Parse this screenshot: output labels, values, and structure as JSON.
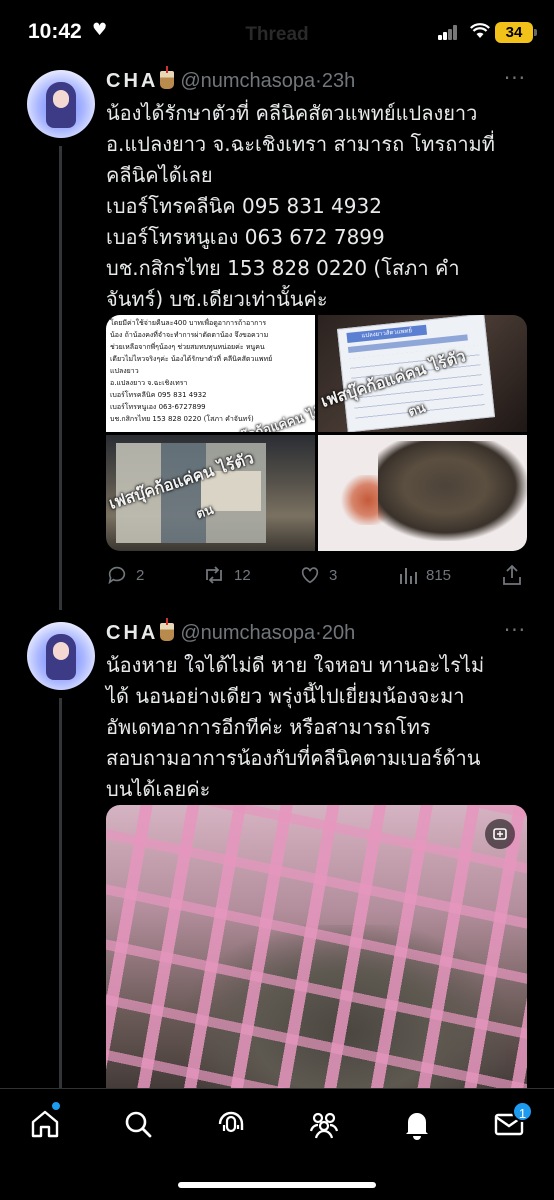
{
  "status_bar": {
    "time": "10:42",
    "header_title": "Thread",
    "battery": "34"
  },
  "tweets": [
    {
      "name": "CHA",
      "handle": "@numchasopa",
      "separator": "·",
      "time": "23h",
      "more": "···",
      "text_lines": [
        "น้องได้รักษาตัวที่ คลีนิคสัตวแพทย์แปลงยาว",
        "อ.แปลงยาว จ.ฉะเชิงเทรา สามารถ โทรถามที่",
        "คลีนิคได้เลย",
        "เบอร์โทรคลีนิค 095 831 4932",
        "เบอร์โทรหนูเอง 063 672 7899",
        "บช.กสิกรไทย 153 828 0220 (โสภา คำ",
        "จันทร์) บช.เดียวเท่านั้นค่ะ"
      ],
      "media_note_lines": [
        "โดยมีค่าใช้จ่ายคืนละ400 บาทเพื่อดูอาการถ้าอาการ",
        "น้อง ถ้าน้องคงที่จำจะทำการผ่าตัดตาน้อง จึงขอความ",
        "ช่วยเหลือจากพี่ๆน้องๆ ช่วยสมทบทุนหน่อยค่ะ หนูคน",
        "เดียวไม่ไหวจริงๆค่ะ น้องได้รักษาตัวที่ คลีนิคสัตวแพทย์",
        "แปลงยาว",
        "อ.แปลงยาว จ.ฉะเชิงเทรา",
        "เบอร์โทรคลีนิค 095 831 4932",
        "เบอร์โทรหนูเอง 063-6727899",
        "บช.กสิกรไทย 153 828 0220 (โสภา คำจันทร์)"
      ],
      "media_watermark_1": "เฟสบุ๊คก้อแค่คน ไร้ตัว",
      "media_watermark_2": "ตน",
      "receipt_title": "แปลงยาวสัตวแพทย์",
      "counts": {
        "replies": "2",
        "retweets": "12",
        "likes": "3",
        "views": "815"
      }
    },
    {
      "name": "CHA",
      "handle": "@numchasopa",
      "separator": "·",
      "time": "20h",
      "more": "···",
      "text_lines": [
        "น้องหาย ใจได้ไม่ดี หาย ใจหอบ ทานอะไรไม่",
        "ได้ นอนอย่างเดียว พรุ่งนี้ไปเยี่ยมน้องจะมา",
        "อัพเดทอาการอีกทีค่ะ หรือสามารถโทร",
        "สอบถามอาการน้องกับที่คลีนิคตามเบอร์ด้าน",
        "บนได้เลยค่ะ"
      ]
    }
  ],
  "tab_bar": {
    "icons": [
      "home-icon",
      "search-icon",
      "spaces-icon",
      "communities-icon",
      "notifications-icon",
      "messages-icon"
    ],
    "messages_badge": "1"
  },
  "colors": {
    "background": "#000000",
    "text": "#e7e9ea",
    "muted": "#71767b",
    "accent": "#1d9bf0",
    "battery": "#f2c21b"
  }
}
